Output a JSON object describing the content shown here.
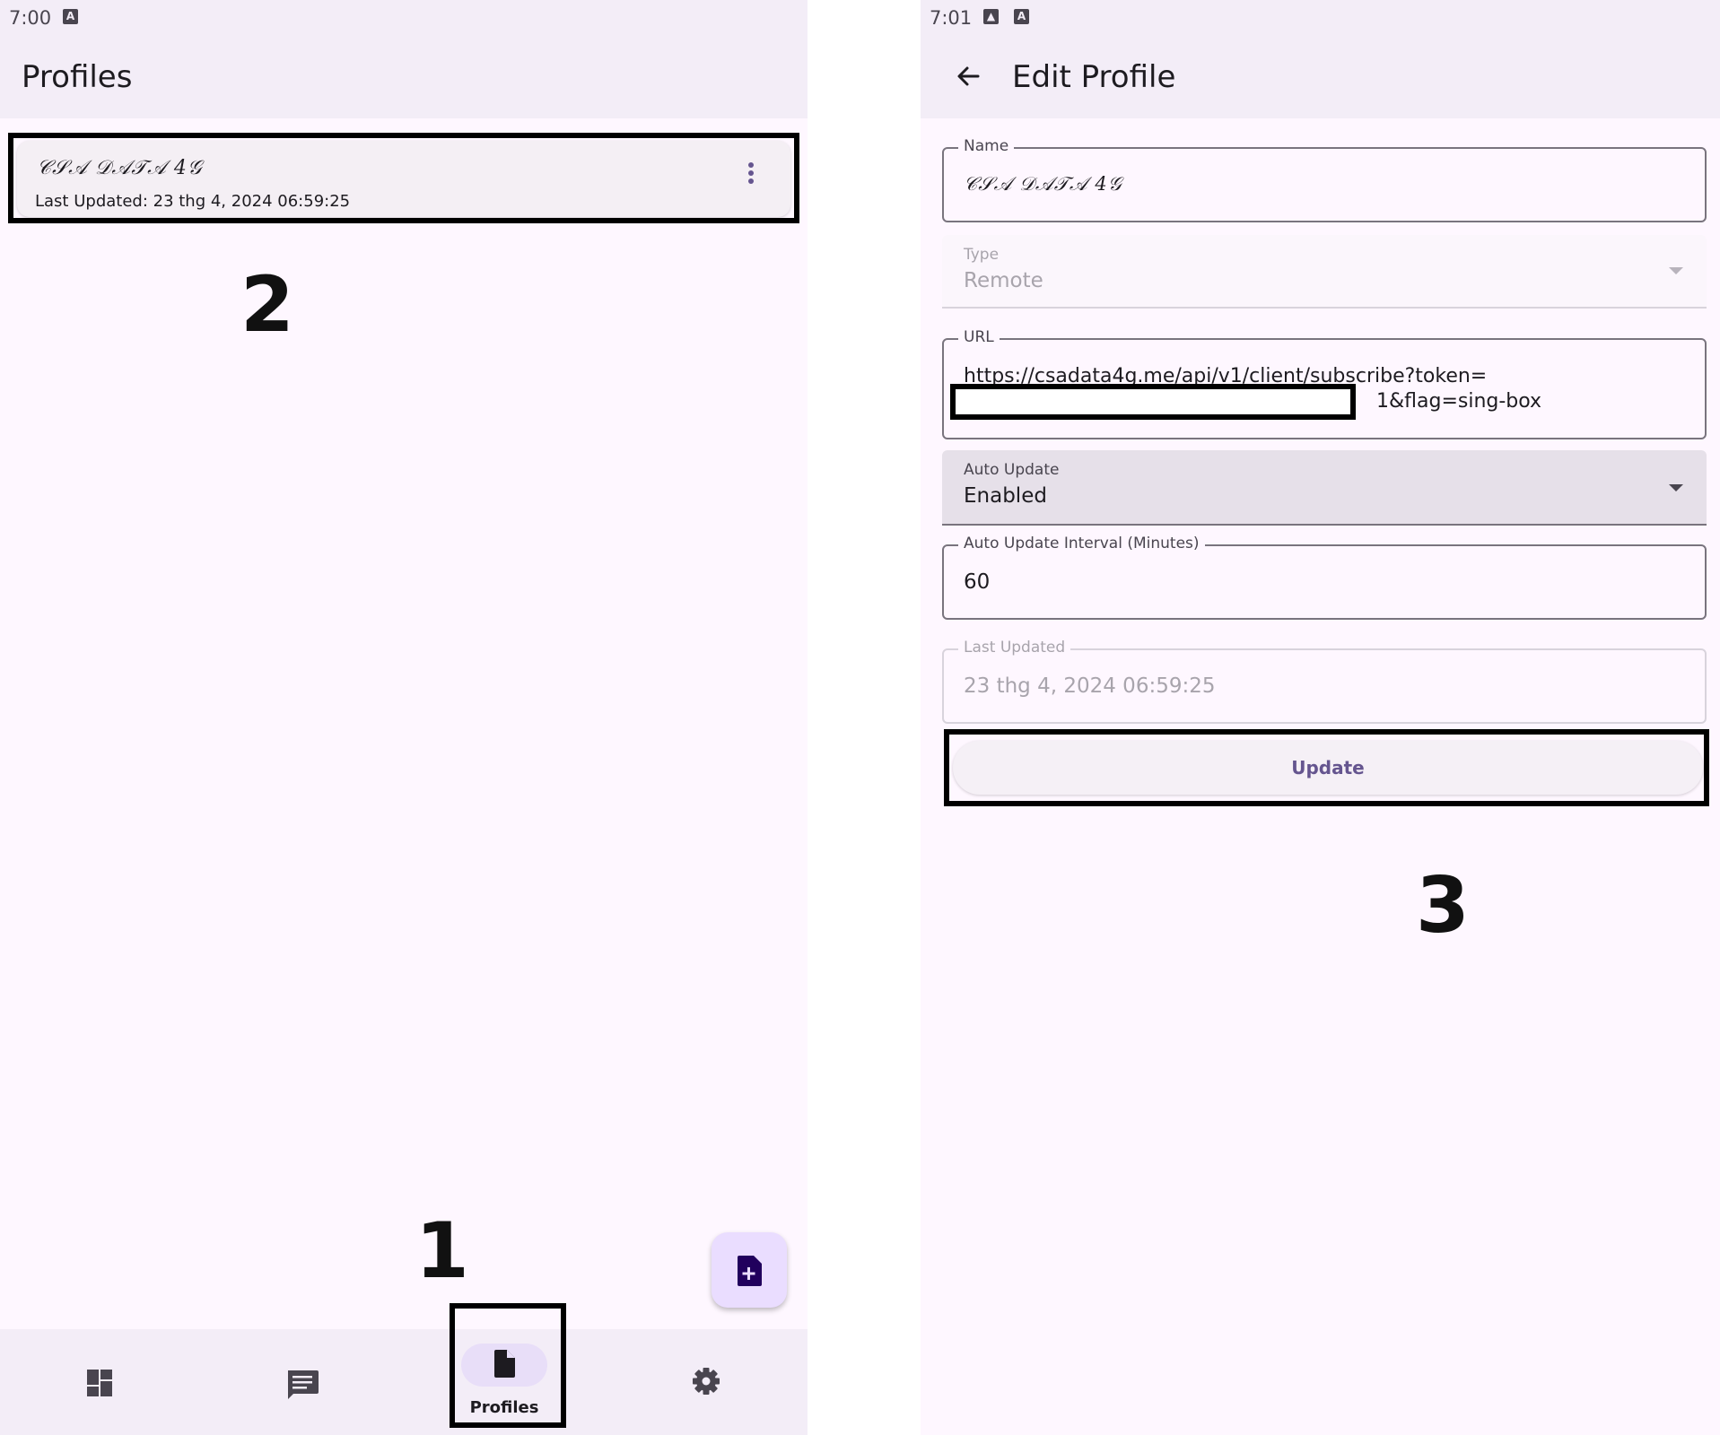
{
  "colors": {
    "surface": "#fef7ff",
    "bar": "#f3edf7",
    "primary": "#65558f",
    "secondary_container": "#e8def8",
    "primary_container": "#eaddff",
    "outline": "#79747e"
  },
  "left": {
    "status": {
      "time": "7:00",
      "icons": [
        "accessibility-icon"
      ]
    },
    "app_bar": {
      "title": "Profiles"
    },
    "profile": {
      "name": "𝒞𝒮𝒜 𝒟𝒜𝒯𝒜 4𝒢",
      "last_updated": "Last Updated: 23 thg 4, 2024 06:59:25",
      "menu_icon": "more-vert-icon"
    },
    "fab_icon": "add-file-icon",
    "nav": {
      "items": [
        {
          "icon": "dashboard-icon",
          "label": ""
        },
        {
          "icon": "message-icon",
          "label": ""
        },
        {
          "icon": "file-icon",
          "label": "Profiles",
          "selected": true
        },
        {
          "icon": "settings-gear-icon",
          "label": ""
        }
      ]
    },
    "annotations": {
      "one": "1",
      "two": "2"
    }
  },
  "right": {
    "status": {
      "time": "7:01",
      "icons": [
        "image-icon",
        "accessibility-icon"
      ]
    },
    "app_bar": {
      "title": "Edit Profile",
      "back_icon": "arrow-back-icon"
    },
    "form": {
      "name": {
        "label": "Name",
        "value": "𝒞𝒮𝒜 𝒟𝒜𝒯𝒜 4𝒢"
      },
      "type": {
        "label": "Type",
        "value": "Remote",
        "disabled": true
      },
      "url": {
        "label": "URL",
        "line1": "https://csadata4g.me/api/v1/client/subscribe?token=",
        "line2": "1&flag=sing-box"
      },
      "auto_update": {
        "label": "Auto Update",
        "value": "Enabled"
      },
      "interval": {
        "label": "Auto Update Interval (Minutes)",
        "value": "60"
      },
      "last_updated": {
        "label": "Last Updated",
        "value": "23 thg 4, 2024 06:59:25",
        "disabled": true
      },
      "update_button": "Update"
    },
    "annotations": {
      "three": "3"
    }
  }
}
